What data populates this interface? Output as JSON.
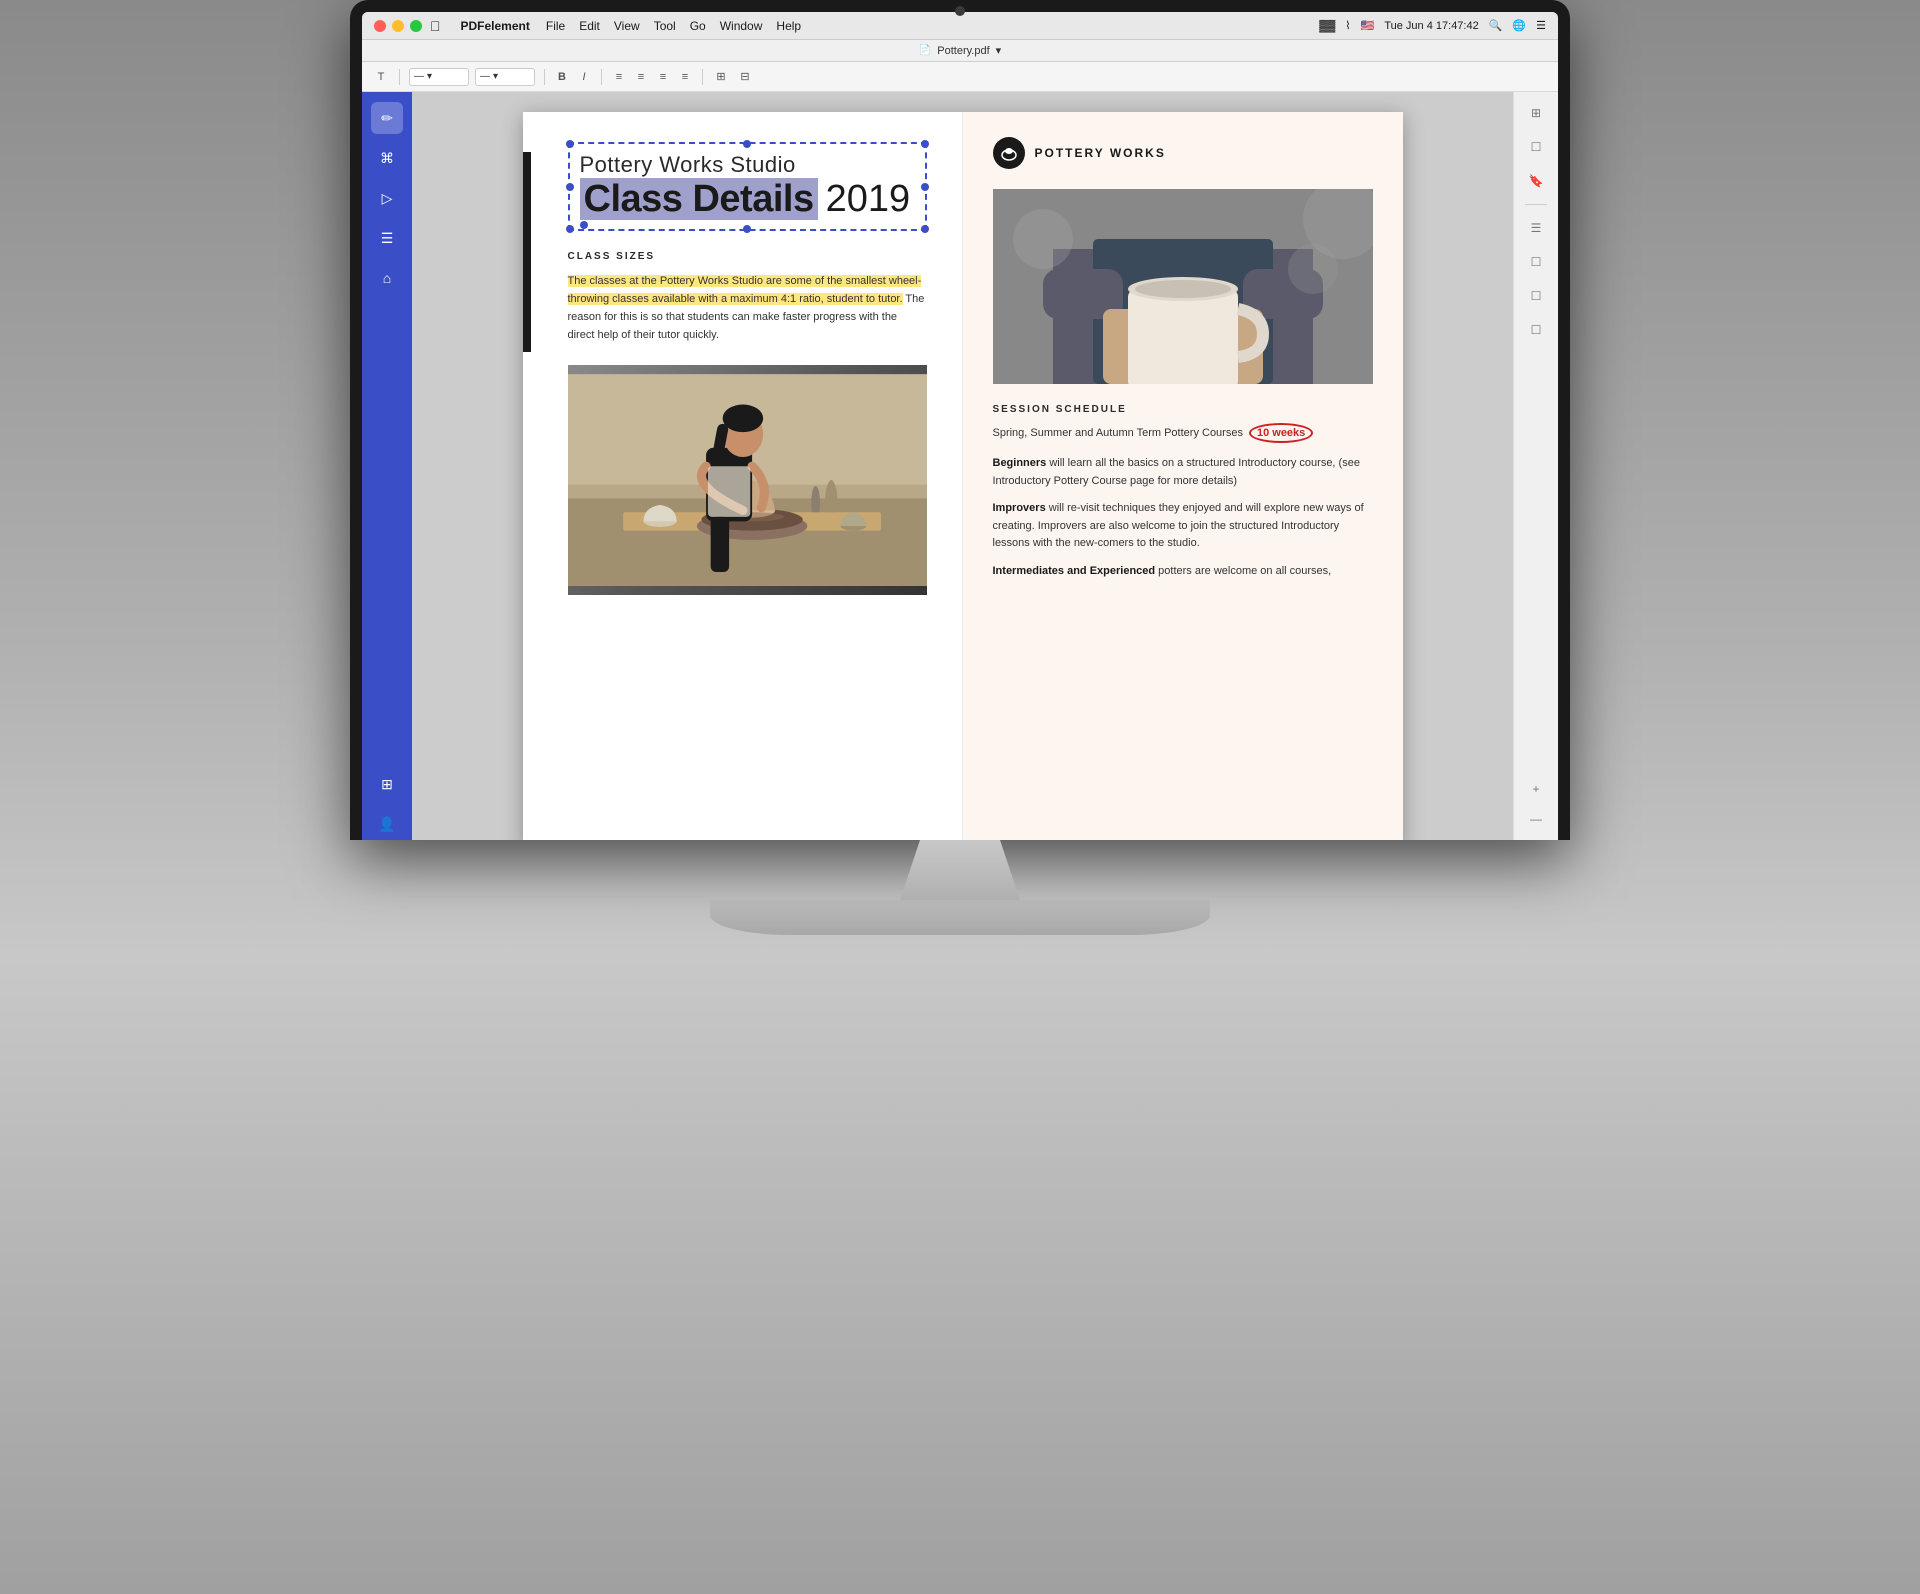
{
  "menubar": {
    "apple": "⌘",
    "app_name": "PDFelement",
    "menus": [
      "File",
      "Edit",
      "View",
      "Tool",
      "Go",
      "Window",
      "Help"
    ],
    "right": {
      "datetime": "Tue Jun 4  17:47:42",
      "wifi": "WiFi",
      "battery": "Batt"
    }
  },
  "titlebar": {
    "filename": "Pottery.pdf",
    "chevron": "▾"
  },
  "toolbar": {
    "text_tool": "T",
    "separator1": "",
    "dropdown1_value": "—",
    "dropdown2_value": "—",
    "bold": "B",
    "italic": "I",
    "align_left": "≡",
    "align_center": "≡",
    "align_right": "≡",
    "align_justify": "≡"
  },
  "pdf": {
    "left_page": {
      "subtitle": "Pottery Works Studio",
      "main_title": "Class Details",
      "year": "2019",
      "class_sizes_heading": "CLASS SIZES",
      "class_sizes_body_highlighted": "The classes at the Pottery Works Studio are some of the smallest wheel-throwing classes available with a maximum 4:1 ratio, student to tutor.",
      "class_sizes_body_normal": " The reason for this is so that students can make faster progress with the direct help of their tutor quickly."
    },
    "right_page": {
      "brand_name": "POTTERY WORKS",
      "brand_logo": "🏺",
      "session_heading": "SESSION SCHEDULE",
      "session_intro": "Spring, Summer and Autumn Term Pottery Courses",
      "weeks_badge": "10 weeks",
      "beginners_label": "Beginners",
      "beginners_text": " will learn all the basics on a structured Introductory course, (see Introductory Pottery Course page for more details)",
      "improvers_label": "Improvers",
      "improvers_text": " will re-visit techniques they enjoyed and will explore new ways of creating. Improvers are also welcome to join the structured Introductory lessons with the new-comers to the studio.",
      "intermediates_label": "Intermediates and Experienced",
      "intermediates_text": " potters are welcome on all courses,"
    }
  },
  "left_sidebar": {
    "icons": [
      "✏️",
      "✉",
      "▷",
      "☰",
      "⌂",
      "⊞",
      "👤"
    ]
  },
  "right_panel": {
    "icons": [
      "⊞",
      "☐",
      "🔖",
      "☰",
      "☐",
      "☐",
      "☐",
      "+",
      "—"
    ]
  }
}
